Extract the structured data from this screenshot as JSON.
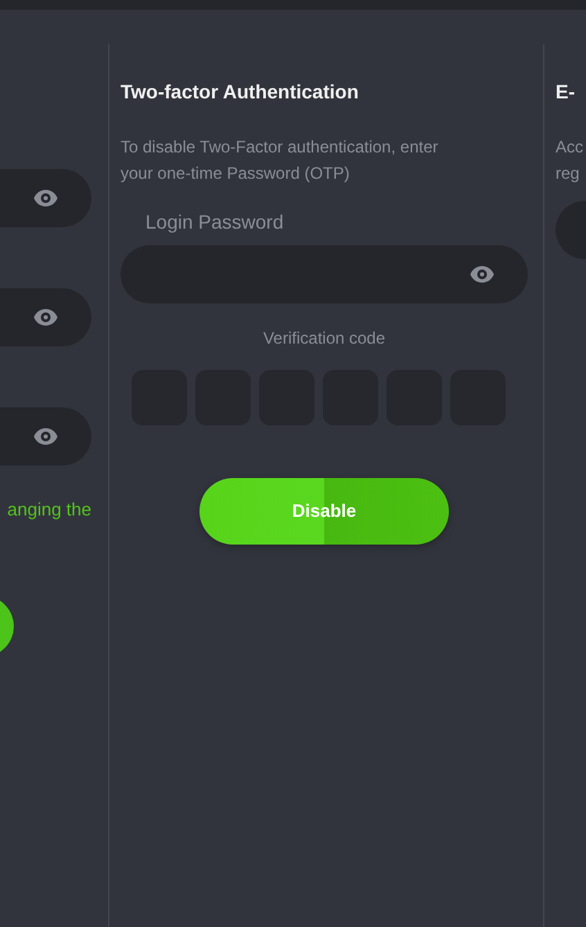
{
  "left_panel": {
    "fields": [
      {
        "kind": "password"
      },
      {
        "kind": "password"
      },
      {
        "kind": "password"
      }
    ],
    "notice": "anging the",
    "button": {
      "kind": "round"
    }
  },
  "two_factor": {
    "title": "Two-factor Authentication",
    "description": "To disable Two-Factor authentication, enter your one-time Password (OTP)",
    "password_label": "Login Password",
    "password_field": {
      "kind": "password"
    },
    "verification_label": "Verification code",
    "code_cells": [
      {
        "kind": "digit"
      },
      {
        "kind": "digit"
      },
      {
        "kind": "digit"
      },
      {
        "kind": "digit"
      },
      {
        "kind": "digit"
      },
      {
        "kind": "digit"
      }
    ],
    "button": "Disable"
  },
  "right_panel": {
    "title": "E-",
    "description_lines": [
      "Acc",
      "reg"
    ],
    "field": {
      "kind": "text"
    }
  }
}
